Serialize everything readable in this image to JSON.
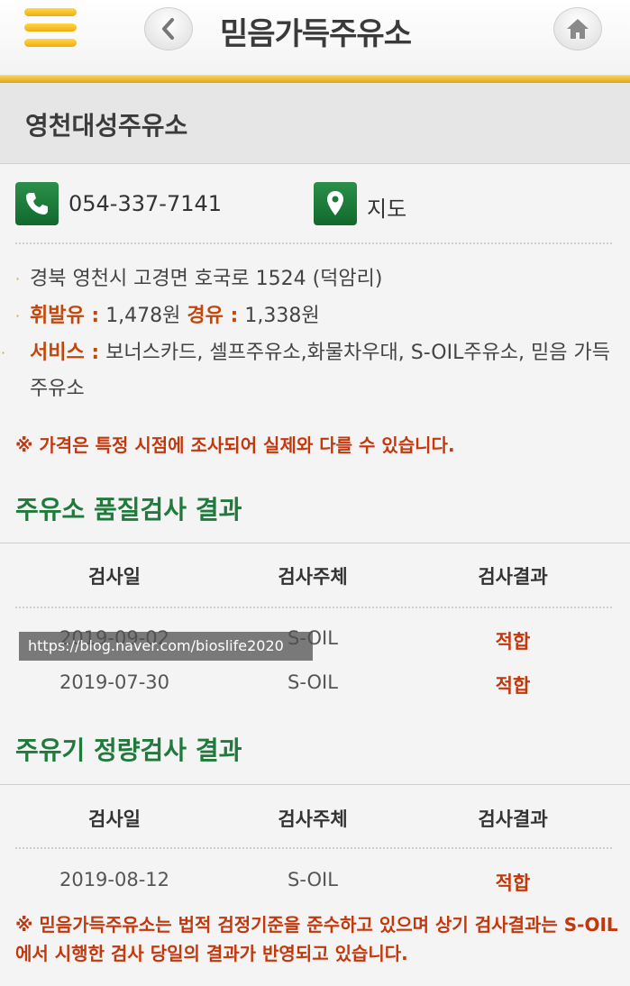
{
  "header": {
    "title": "믿음가득주유소",
    "menu_icon": "menu-icon",
    "back_icon": "chevron-left-icon",
    "home_icon": "home-icon"
  },
  "station": {
    "name": "영천대성주유소",
    "phone": "054-337-7141",
    "map_label": "지도"
  },
  "info": {
    "address": "경북 영천시 고경면 호국로 1524 (덕암리)",
    "gasoline_label": "휘발유 :",
    "gasoline_price": "1,478원",
    "diesel_label": "경유 :",
    "diesel_price": "1,338원",
    "service_label": "서비스 :",
    "services": "보너스카드, 셀프주유소,화물차우대, S-OIL주유소, 믿음 가득 주유소",
    "price_notice": "※ 가격은 특정 시점에 조사되어 실제와 다를 수 있습니다."
  },
  "quality": {
    "title": "주유소 품질검사 결과",
    "headers": [
      "검사일",
      "검사주체",
      "검사결과"
    ],
    "rows": [
      {
        "date": "2019-09-02",
        "agency": "S-OIL",
        "result": "적합"
      },
      {
        "date": "2019-07-30",
        "agency": "S-OIL",
        "result": "적합"
      }
    ]
  },
  "metering": {
    "title": "주유기 정량검사 결과",
    "headers": [
      "검사일",
      "검사주체",
      "검사결과"
    ],
    "rows": [
      {
        "date": "2019-08-12",
        "agency": "S-OIL",
        "result": "적합"
      }
    ]
  },
  "watermark": "https://blog.naver.com/bioslife2020",
  "footer_note": "※ 믿음가득주유소는 법적 검정기준을 준수하고 있으며 상기 검사결과는 S-OIL에서 시행한 검사 당일의 결과가 반영되고 있습니다.",
  "colors": {
    "accent_gold": "#f1ac0d",
    "green": "#1f7a3c",
    "red": "#c2380d"
  }
}
